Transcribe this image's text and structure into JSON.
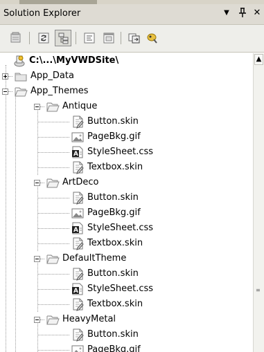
{
  "panel": {
    "title": "Solution Explorer",
    "dropdown_glyph": "▼",
    "pin_glyph": "ᵾ",
    "close_glyph": "✕"
  },
  "toolbar": {
    "buttons": [
      "properties-icon",
      "refresh-icon",
      "nest-related-files-icon",
      "view-code-icon",
      "view-designer-icon",
      "copy-website-icon",
      "aspnet-configuration-icon"
    ]
  },
  "tree": {
    "root": "C:\\...\\MyVWDSite\\",
    "app_data": "App_Data",
    "app_themes": "App_Themes",
    "themes": [
      {
        "name": "Antique",
        "files": [
          "Button.skin",
          "PageBkg.gif",
          "StyleSheet.css",
          "Textbox.skin"
        ]
      },
      {
        "name": "ArtDeco",
        "files": [
          "Button.skin",
          "PageBkg.gif",
          "StyleSheet.css",
          "Textbox.skin"
        ]
      },
      {
        "name": "DefaultTheme",
        "files": [
          "Button.skin",
          "StyleSheet.css",
          "Textbox.skin"
        ]
      },
      {
        "name": "HeavyMetal",
        "files": [
          "Button.skin",
          "PageBkg.gif"
        ]
      }
    ]
  }
}
